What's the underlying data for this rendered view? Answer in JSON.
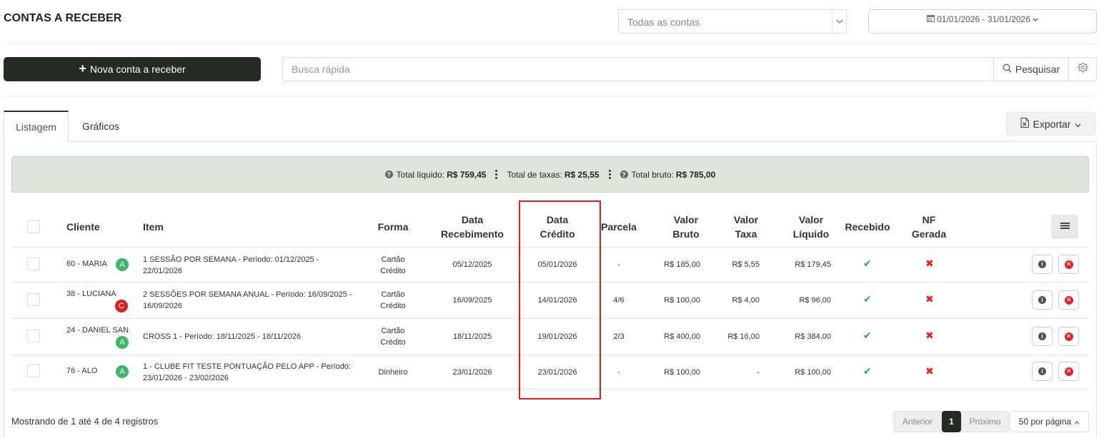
{
  "header": {
    "title": "CONTAS A RECEBER",
    "account_select": "Todas as contas",
    "date_range": "01/01/2026 - 31/01/2026"
  },
  "toolbar": {
    "new_button": "Nova conta a receber",
    "search_placeholder": "Busca rápida",
    "search_button": "Pesquisar"
  },
  "tabs": [
    {
      "label": "Listagem",
      "active": true
    },
    {
      "label": "Gráficos",
      "active": false
    }
  ],
  "export_label": "Exportar",
  "totals": {
    "liquido_label": "Total líquido:",
    "liquido_value": "R$ 759,45",
    "taxas_label": "Total de taxas:",
    "taxas_value": "R$ 25,55",
    "bruto_label": "Total bruto:",
    "bruto_value": "R$ 785,00"
  },
  "table": {
    "headers": {
      "cliente": "Cliente",
      "item": "Item",
      "forma": "Forma",
      "data_recebimento_1": "Data",
      "data_recebimento_2": "Recebimento",
      "data_credito_1": "Data",
      "data_credito_2": "Crédito",
      "parcela": "Parcela",
      "valor_bruto_1": "Valor",
      "valor_bruto_2": "Bruto",
      "valor_taxa_1": "Valor",
      "valor_taxa_2": "Taxa",
      "valor_liquido_1": "Valor",
      "valor_liquido_2": "Líquido",
      "recebido": "Recebido",
      "nf_1": "NF",
      "nf_2": "Gerada"
    },
    "rows": [
      {
        "cliente": "60 - MARIA",
        "badge": "A",
        "item": "1 SESSÃO POR SEMANA - Período: 01/12/2025 - 22/01/2026",
        "forma": "Cartão Crédito",
        "data_recebimento": "05/12/2025",
        "data_credito": "05/01/2026",
        "parcela": "-",
        "valor_bruto": "R$ 185,00",
        "valor_taxa": "R$ 5,55",
        "valor_liquido": "R$ 179,45"
      },
      {
        "cliente": "38 - LUCIANA",
        "badge": "C",
        "item": "2 SESSÕES POR SEMANA ANUAL - Período: 16/09/2025 - 16/09/2026",
        "forma": "Cartão Crédito",
        "data_recebimento": "16/09/2025",
        "data_credito": "14/01/2026",
        "parcela": "4/6",
        "valor_bruto": "R$ 100,00",
        "valor_taxa": "R$ 4,00",
        "valor_liquido": "R$ 96,00"
      },
      {
        "cliente": "24 - DANIEL SAN",
        "badge": "A",
        "item": "CROSS 1 - Período: 18/11/2025 - 18/11/2026",
        "forma": "Cartão Crédito",
        "data_recebimento": "18/11/2025",
        "data_credito": "19/01/2026",
        "parcela": "2/3",
        "valor_bruto": "R$ 400,00",
        "valor_taxa": "R$ 16,00",
        "valor_liquido": "R$ 384,00"
      },
      {
        "cliente": "76 - ALO",
        "badge": "A",
        "item": "1 - CLUBE FIT TESTE PONTUAÇÃO PELO APP - Período: 23/01/2026 - 23/02/2026",
        "forma": "Dinheiro",
        "data_recebimento": "23/01/2026",
        "data_credito": "23/01/2026",
        "parcela": "-",
        "valor_bruto": "R$ 100,00",
        "valor_taxa": "-",
        "valor_liquido": "R$ 100,00"
      }
    ]
  },
  "footer": {
    "info": "Mostrando de 1 até 4 de 4 registros",
    "prev": "Anterior",
    "current_page": "1",
    "next": "Próximo",
    "per_page": "50 por página"
  },
  "colors": {
    "primary_dark": "#262a25",
    "totals_bg": "#dfe5dd",
    "success": "#2fa45a",
    "danger": "#e02424",
    "highlight": "#e11d1d"
  }
}
